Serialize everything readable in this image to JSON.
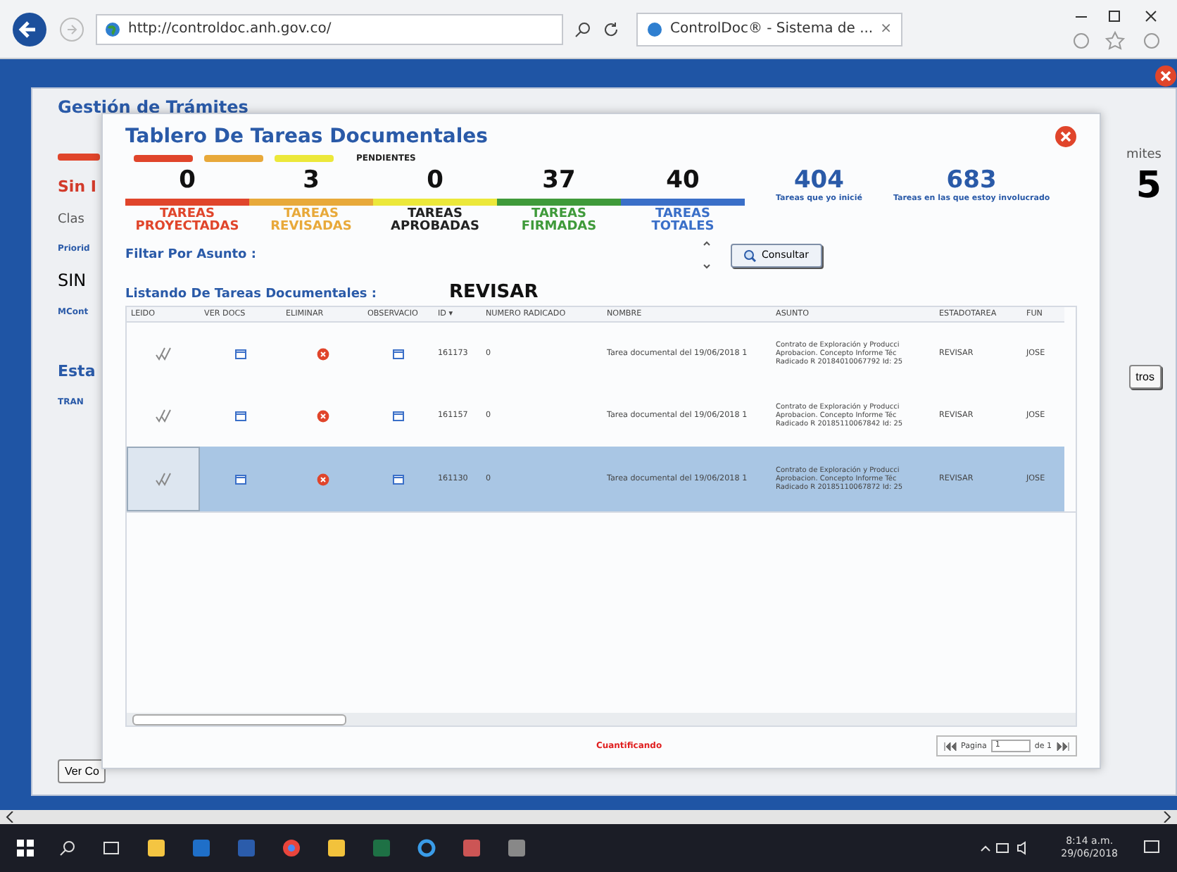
{
  "browser": {
    "address": "http://controldoc.anh.gov.co/",
    "tab_title": "ControlDoc® - Sistema de ...",
    "tab_close": "×"
  },
  "background_page": {
    "title": "Gestión de Trámites",
    "left_fragments": [
      {
        "kind": "alert",
        "text": "Sin I"
      },
      {
        "kind": "label",
        "text": "Clas"
      },
      {
        "kind": "small",
        "text": "Priorid"
      },
      {
        "kind": "value",
        "text": "SIN"
      },
      {
        "kind": "small",
        "text": "MCont"
      },
      {
        "kind": "heading",
        "text": "Esta"
      },
      {
        "kind": "small",
        "text": "TRAN"
      }
    ],
    "right_fragments": [
      {
        "kind": "label",
        "text": "mites"
      },
      {
        "kind": "big",
        "text": "5"
      }
    ],
    "right_button": "tros",
    "bottom_button": "Ver Co"
  },
  "modal": {
    "title": "Tablero De Tareas Documentales",
    "pending_label": "PENDIENTES",
    "pending_bars": [
      {
        "color": "#e0452b"
      },
      {
        "color": "#e8a93a"
      },
      {
        "color": "#ece83a"
      }
    ],
    "stats": [
      {
        "value": "0",
        "label": "TAREAS PROYECTADAS",
        "color": "#e0452b"
      },
      {
        "value": "3",
        "label": "TAREAS REVISADAS",
        "color": "#e8a93a"
      },
      {
        "value": "0",
        "label": "TAREAS APROBADAS",
        "color": "#ece83a"
      },
      {
        "value": "37",
        "label": "TAREAS FIRMADAS",
        "color": "#3f9a3a"
      },
      {
        "value": "40",
        "label": "TAREAS TOTALES",
        "color": "#3a6fc8"
      }
    ],
    "summary": [
      {
        "value": "404",
        "label": "Tareas que yo inicié"
      },
      {
        "value": "683",
        "label": "Tareas en las que estoy involucrado"
      }
    ],
    "filter_label": "Filtar Por Asunto :",
    "consult_button": "Consultar",
    "list_label": "Listando De Tareas Documentales :",
    "list_state": "REVISAR",
    "columns": [
      "LEIDO",
      "VER DOCS",
      "ELIMINAR",
      "OBSERVACIO",
      "ID ▾",
      "NUMERO RADICADO",
      "NOMBRE",
      "ASUNTO",
      "ESTADOTAREA",
      "FUN"
    ],
    "rows": [
      {
        "selected": false,
        "id": "161173",
        "radicado": "0",
        "nombre": "Tarea documental del 19/06/2018 1",
        "asunto": [
          "Contrato de Exploración y Producci",
          "Aprobacion. Concepto Informe Téc",
          "Radicado R 20184010067792 Id: 25"
        ],
        "estado": "REVISAR",
        "fun": "JOSE"
      },
      {
        "selected": false,
        "id": "161157",
        "radicado": "0",
        "nombre": "Tarea documental del 19/06/2018 1",
        "asunto": [
          "Contrato de Exploración y Producci",
          "Aprobacion. Concepto Informe Téc",
          "Radicado R 20185110067842 Id: 25"
        ],
        "estado": "REVISAR",
        "fun": "JOSE"
      },
      {
        "selected": true,
        "id": "161130",
        "radicado": "0",
        "nombre": "Tarea documental del 19/06/2018 1",
        "asunto": [
          "Contrato de Exploración y Producci",
          "Aprobacion. Concepto Informe Téc",
          "Radicado R 20185110067872 Id: 25"
        ],
        "estado": "REVISAR",
        "fun": "JOSE"
      }
    ],
    "status": "Cuantificando",
    "pager": {
      "page_label": "Pagina",
      "page": "1",
      "of": "de 1"
    }
  },
  "taskbar": {
    "time": "8:14 a.m.",
    "date": "29/06/2018"
  }
}
